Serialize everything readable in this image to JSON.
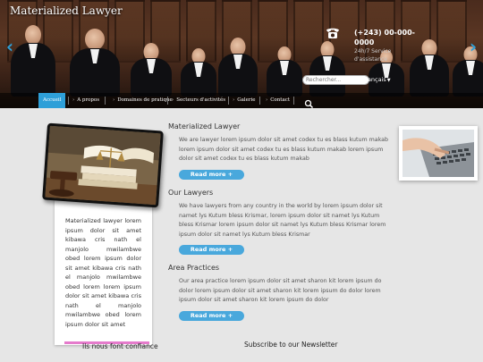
{
  "header": {
    "logo": "Materialized Lawyer",
    "phone": "(+243) 00-000-0000",
    "service": "24h/7 Service d'assistance",
    "search_placeholder": "Rechercher...",
    "language": "Français"
  },
  "nav": {
    "items": [
      {
        "label": "Accueil",
        "active": true
      },
      {
        "label": "A propos"
      },
      {
        "label": "Domaines de pratique"
      },
      {
        "label": "Secteurs d'activités"
      },
      {
        "label": "Galerie"
      },
      {
        "label": "Contact"
      }
    ]
  },
  "card": {
    "text": "Materialized lawyer lorem ipsum dolor sit amet kibawa cris nath el manjolo mwilambwe obed lorem ipsum dolor sit amet kibawa cris nath el manjolo mwilambwe obed lorem lorem ipsum dolor sit amet kibawa cris nath el manjolo mwilambwe obed lorem ipsum dolor sit amet"
  },
  "sections": [
    {
      "title": "Materialized Lawyer",
      "text": "We are lawyer lorem ipsum dolor sit amet codex tu es blass kutum makab lorem ipsum dolor sit amet codex tu es blass kutum makab lorem ipsum dolor sit amet codex tu es blass kutum makab",
      "button": "Read more +"
    },
    {
      "title": "Our Lawyers",
      "text": "We have lawyers from any country in the world by lorem ipsum dolor sit namet lys Kutum bless Krismar, lorem ipsum dolor sit namet lys Kutum bless Krismar lorem ipsum dolor sit namet lys Kutum bless Krismar lorem ipsum dolor sit namet lys Kutum bless Krismar",
      "button": "Read more +"
    },
    {
      "title": "Area Practices",
      "text": "Our area practice lorem ipsum dolor sit amet sharon kit lorem ipsum do dolor lorem ipsum dolor sit amet sharon kit lorem ipsum do dolor lorem ipsum dolor sit amet sharon kit lorem ipsum do dolor",
      "button": "Read more +"
    }
  ],
  "footer": {
    "left_text": "Ils nous font confiance",
    "newsletter": "Subscribe to our Newsletter"
  },
  "colors": {
    "accent": "#2e9fd8",
    "button": "#49a8dc",
    "pink": "#e57bcc"
  },
  "icons": {
    "phone": "telephone-icon",
    "search": "search-icon",
    "prev": "chevron-left-icon",
    "next": "chevron-right-icon"
  }
}
